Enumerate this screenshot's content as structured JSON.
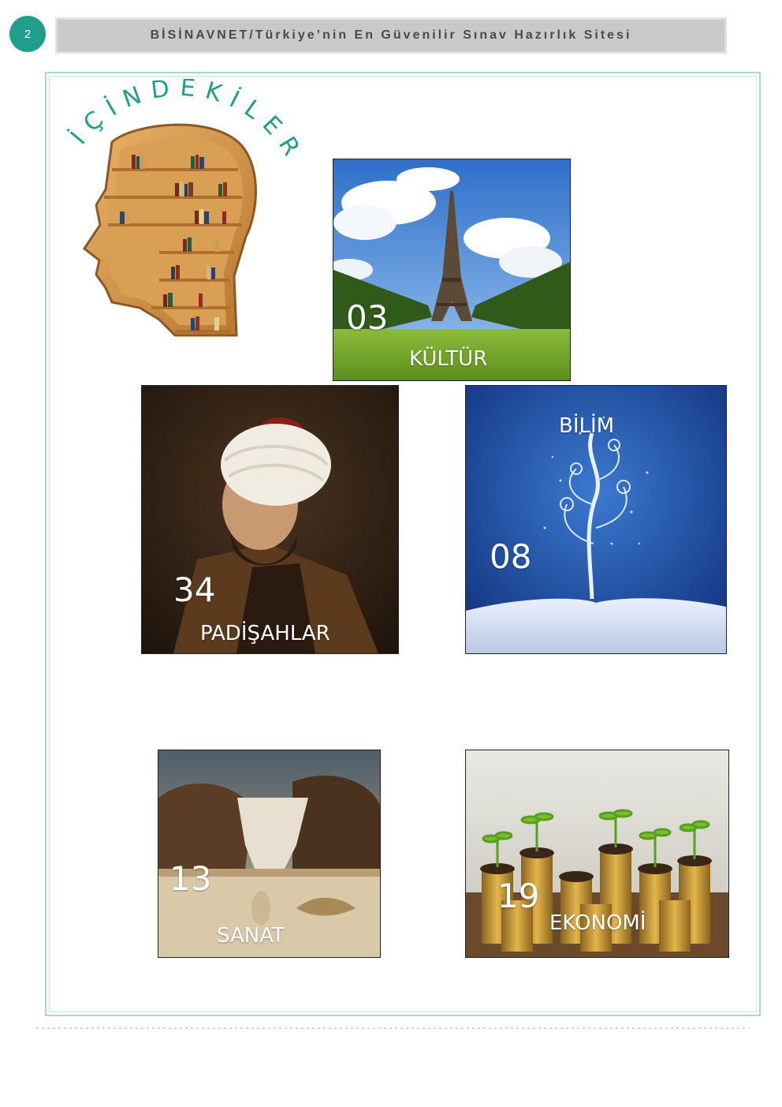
{
  "page_number": "2",
  "header": {
    "title": "BİSİNAVNET/Türkiye’nin En Güvenilir Sınav Hazırlık Sitesi"
  },
  "logo": {
    "heading": "İÇİNDEKİLER",
    "icon": "bookshelf-head-icon"
  },
  "sections": [
    {
      "id": "kultur",
      "number": "03",
      "title": "KÜLTÜR",
      "image": "eiffel-tower-photo"
    },
    {
      "id": "padisahlar",
      "number": "34",
      "title": "PADİŞAHLAR",
      "image": "sultan-portrait"
    },
    {
      "id": "bilim",
      "number": "08",
      "title": "BİLİM",
      "image": "blue-tree-illustration"
    },
    {
      "id": "sanat",
      "number": "13",
      "title": "SANAT",
      "image": "surreal-painting"
    },
    {
      "id": "ekonomi",
      "number": "19",
      "title": "EKONOMİ",
      "image": "coins-sprouts-photo"
    }
  ],
  "colors": {
    "accent": "#1f9e8c",
    "frame": "#a8d8cb",
    "header_bg": "#c9c9c9"
  }
}
